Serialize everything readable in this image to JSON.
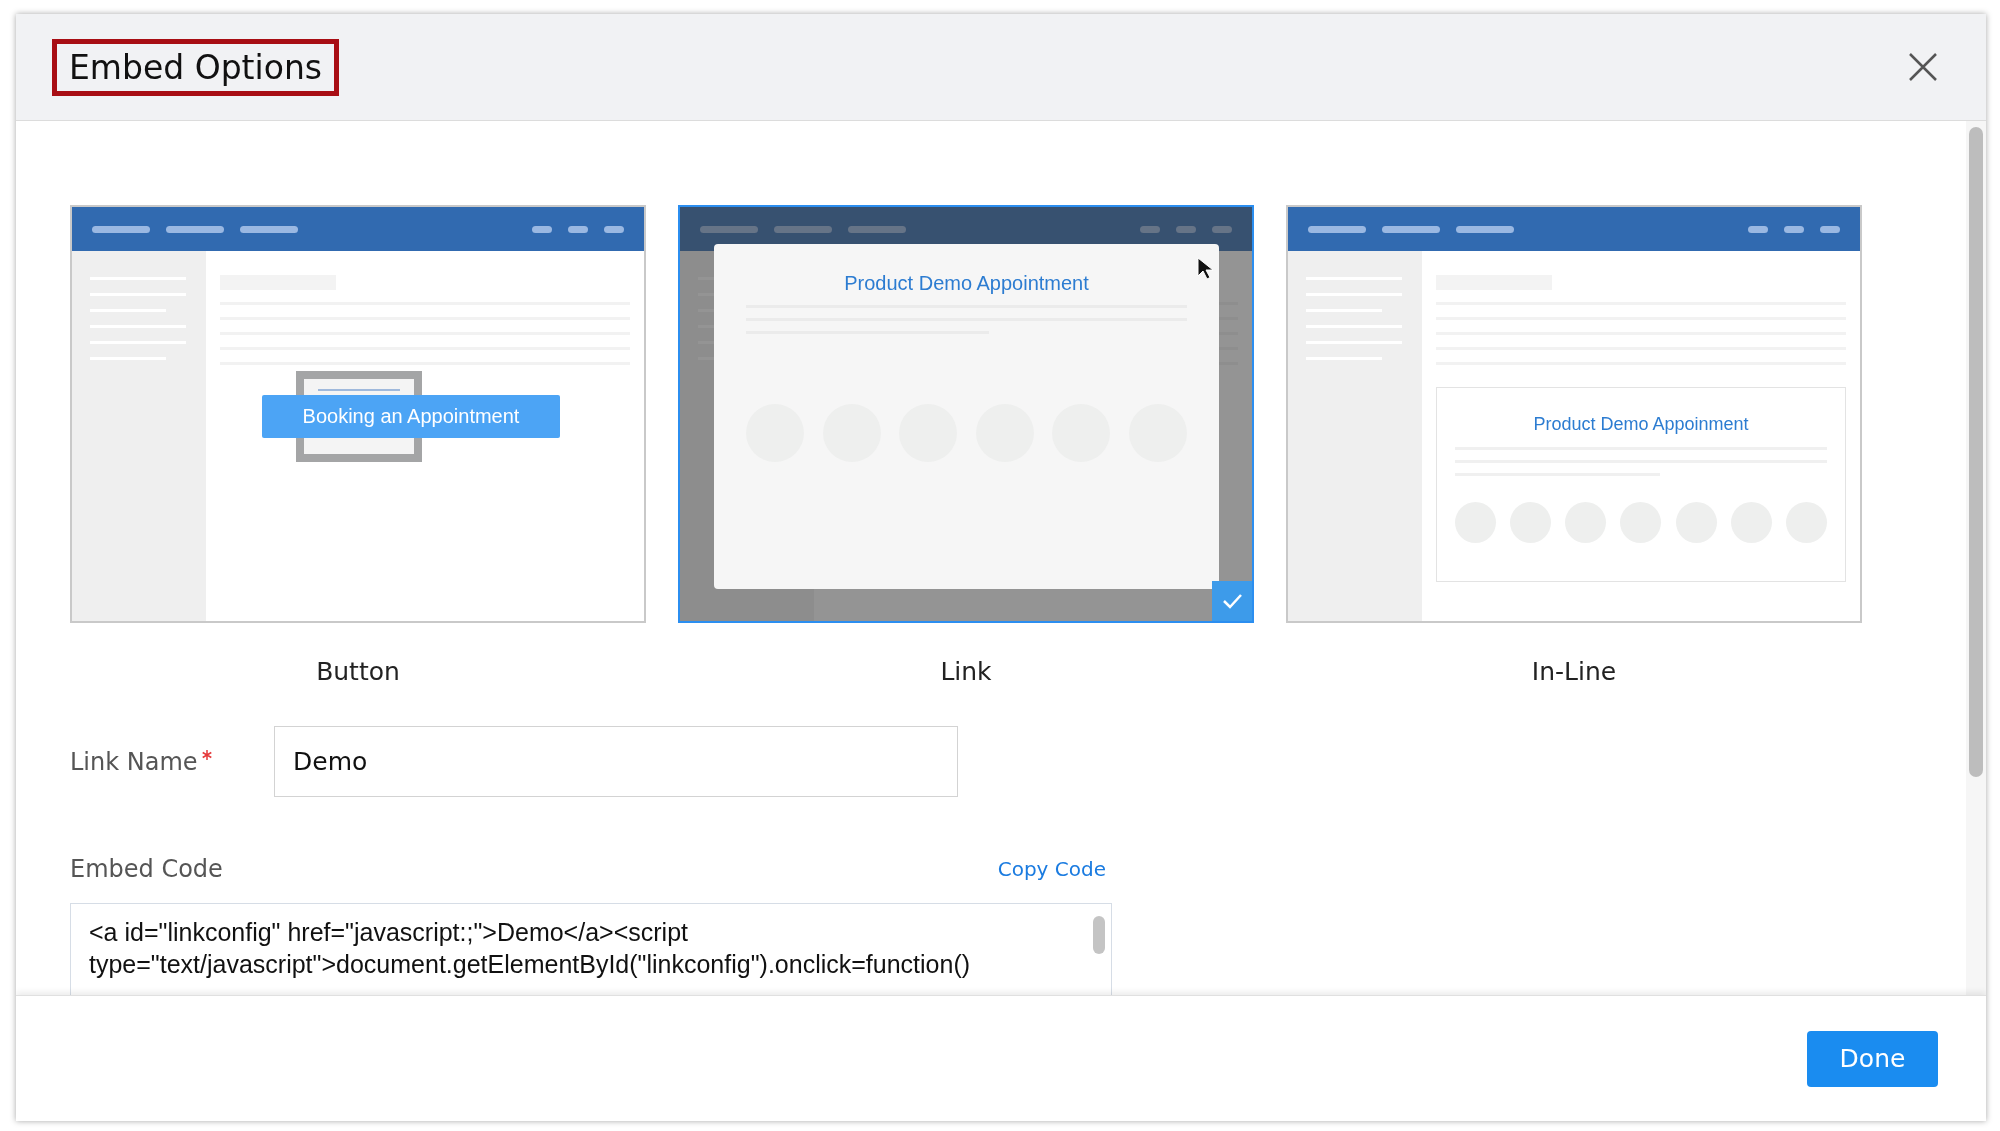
{
  "dialog": {
    "title": "Embed Options",
    "title_highlighted": true
  },
  "options": [
    {
      "kind": "button",
      "label": "Button",
      "selected": false,
      "preview_text": "Booking an Appointment"
    },
    {
      "kind": "link",
      "label": "Link",
      "selected": true,
      "preview_text": "Product Demo Appointment"
    },
    {
      "kind": "inline",
      "label": "In-Line",
      "selected": false,
      "preview_text": "Product Demo Appoinment"
    }
  ],
  "link_name": {
    "label": "Link Name",
    "required": true,
    "value": "Demo"
  },
  "embed_code": {
    "label": "Embed Code",
    "copy_link": "Copy Code",
    "lines": [
      "<a id=\"linkconfig\" href=\"javascript:;\">Demo</a><script",
      "type=\"text/javascript\">document.getElementById(\"linkconfig\").onclick=function()"
    ]
  },
  "footer": {
    "done_button": "Done"
  }
}
